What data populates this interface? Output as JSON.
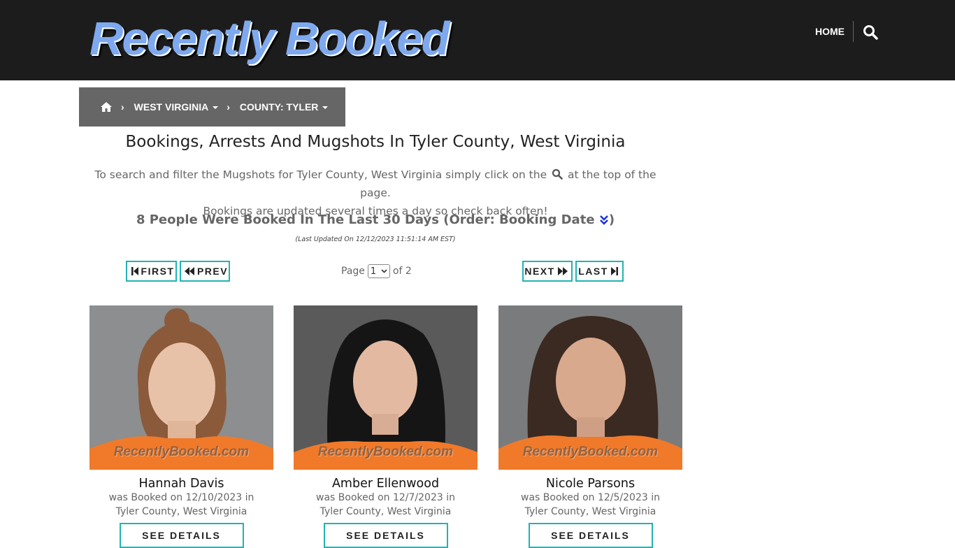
{
  "header": {
    "logo_text": "Recently Booked",
    "nav_home": "HOME",
    "search_icon": "search-icon"
  },
  "breadcrumb": {
    "home_icon": "home-icon",
    "state": "WEST VIRGINIA",
    "county": "COUNTY: TYLER"
  },
  "page": {
    "title": "Bookings, Arrests And Mugshots In Tyler County, West Virginia",
    "intro_before": "To search and filter the Mugshots for Tyler County, West Virginia simply click on the",
    "intro_after": "at the top of the page.",
    "intro_line2": "Bookings are updated several times a day so check back often!",
    "count_text": "8 People Were Booked In The Last 30 Days (Order: Booking Date",
    "count_close": ")",
    "last_updated": "(Last Updated On 12/12/2023 11:51:14 AM EST)"
  },
  "pagination": {
    "first": "FIRST",
    "prev": "PREV",
    "next": "NEXT",
    "last": "LAST",
    "page_label": "Page",
    "current_page": "1",
    "of_label": "of 2"
  },
  "bookings": [
    {
      "name": "Hannah Davis",
      "booked_line": "was Booked on 12/10/2023 in",
      "location": "Tyler County, West Virginia",
      "watermark": "RecentlyBooked.com",
      "button": "SEE DETAILS"
    },
    {
      "name": "Amber Ellenwood",
      "booked_line": "was Booked on 12/7/2023 in",
      "location": "Tyler County, West Virginia",
      "watermark": "RecentlyBooked.com",
      "button": "SEE DETAILS"
    },
    {
      "name": "Nicole Parsons",
      "booked_line": "was Booked on 12/5/2023 in",
      "location": "Tyler County, West Virginia",
      "watermark": "RecentlyBooked.com",
      "button": "SEE DETAILS"
    }
  ],
  "colors": {
    "topbar": "#1c1c1c",
    "accent_teal": "#22b3b3",
    "breadcrumb_bg": "#666666",
    "inmate_orange": "#f07a2a"
  }
}
